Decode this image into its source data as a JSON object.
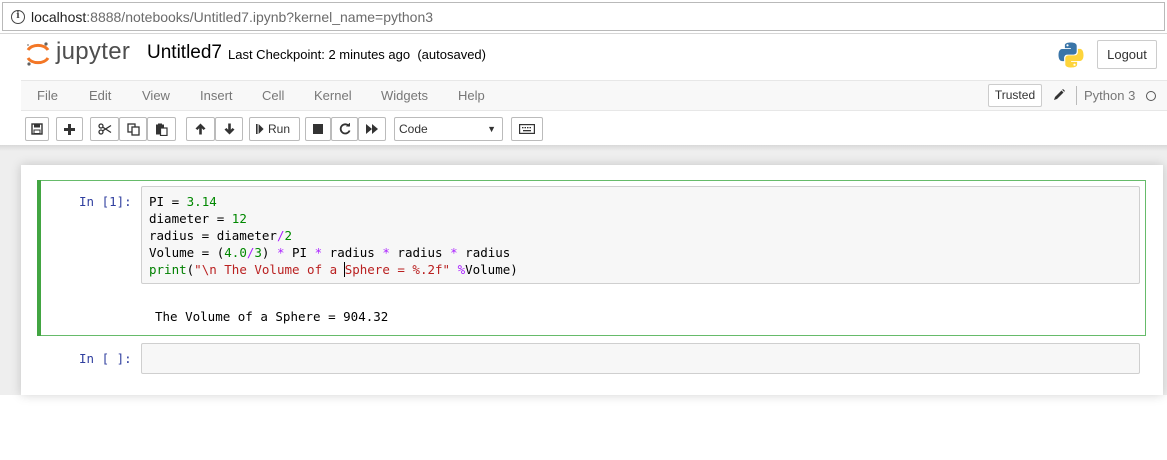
{
  "browser": {
    "url_host": "localhost",
    "url_rest": ":8888/notebooks/Untitled7.ipynb?kernel_name=python3"
  },
  "header": {
    "logo_text": "jupyter",
    "notebook_title": "Untitled7",
    "checkpoint_text": "Last Checkpoint: 2 minutes ago",
    "autosave_text": "(autosaved)",
    "logout_label": "Logout"
  },
  "menubar": {
    "items": [
      "File",
      "Edit",
      "View",
      "Insert",
      "Cell",
      "Kernel",
      "Widgets",
      "Help"
    ],
    "trusted_label": "Trusted",
    "kernel_name": "Python 3"
  },
  "toolbar": {
    "run_label": "Run",
    "cell_type": "Code",
    "buttons": [
      "save-icon",
      "plus-icon",
      "cut-icon",
      "copy-icon",
      "paste-icon",
      "arrow-up-icon",
      "arrow-down-icon",
      "step-forward-icon",
      "stop-icon",
      "refresh-icon",
      "fast-forward-icon",
      "keyboard-icon"
    ]
  },
  "cells": [
    {
      "prompt": "In [1]:",
      "code_lines": [
        "PI = 3.14",
        "diameter = 12",
        "radius = diameter/2",
        "Volume = (4.0/3) * PI * radius * radius * radius",
        "print(\"\\n The Volume of a Sphere = %.2f\" %Volume)"
      ],
      "output": "The Volume of a Sphere = 904.32"
    },
    {
      "prompt": "In [ ]:",
      "code_lines": []
    }
  ],
  "colors": {
    "selected_cell_border": "#66bb6a",
    "prompt_blue": "#303f9f",
    "keyword_green": "#008000",
    "operator_purple": "#aa22ff",
    "string_red": "#ba2121",
    "logo_orange": "#f37726"
  }
}
